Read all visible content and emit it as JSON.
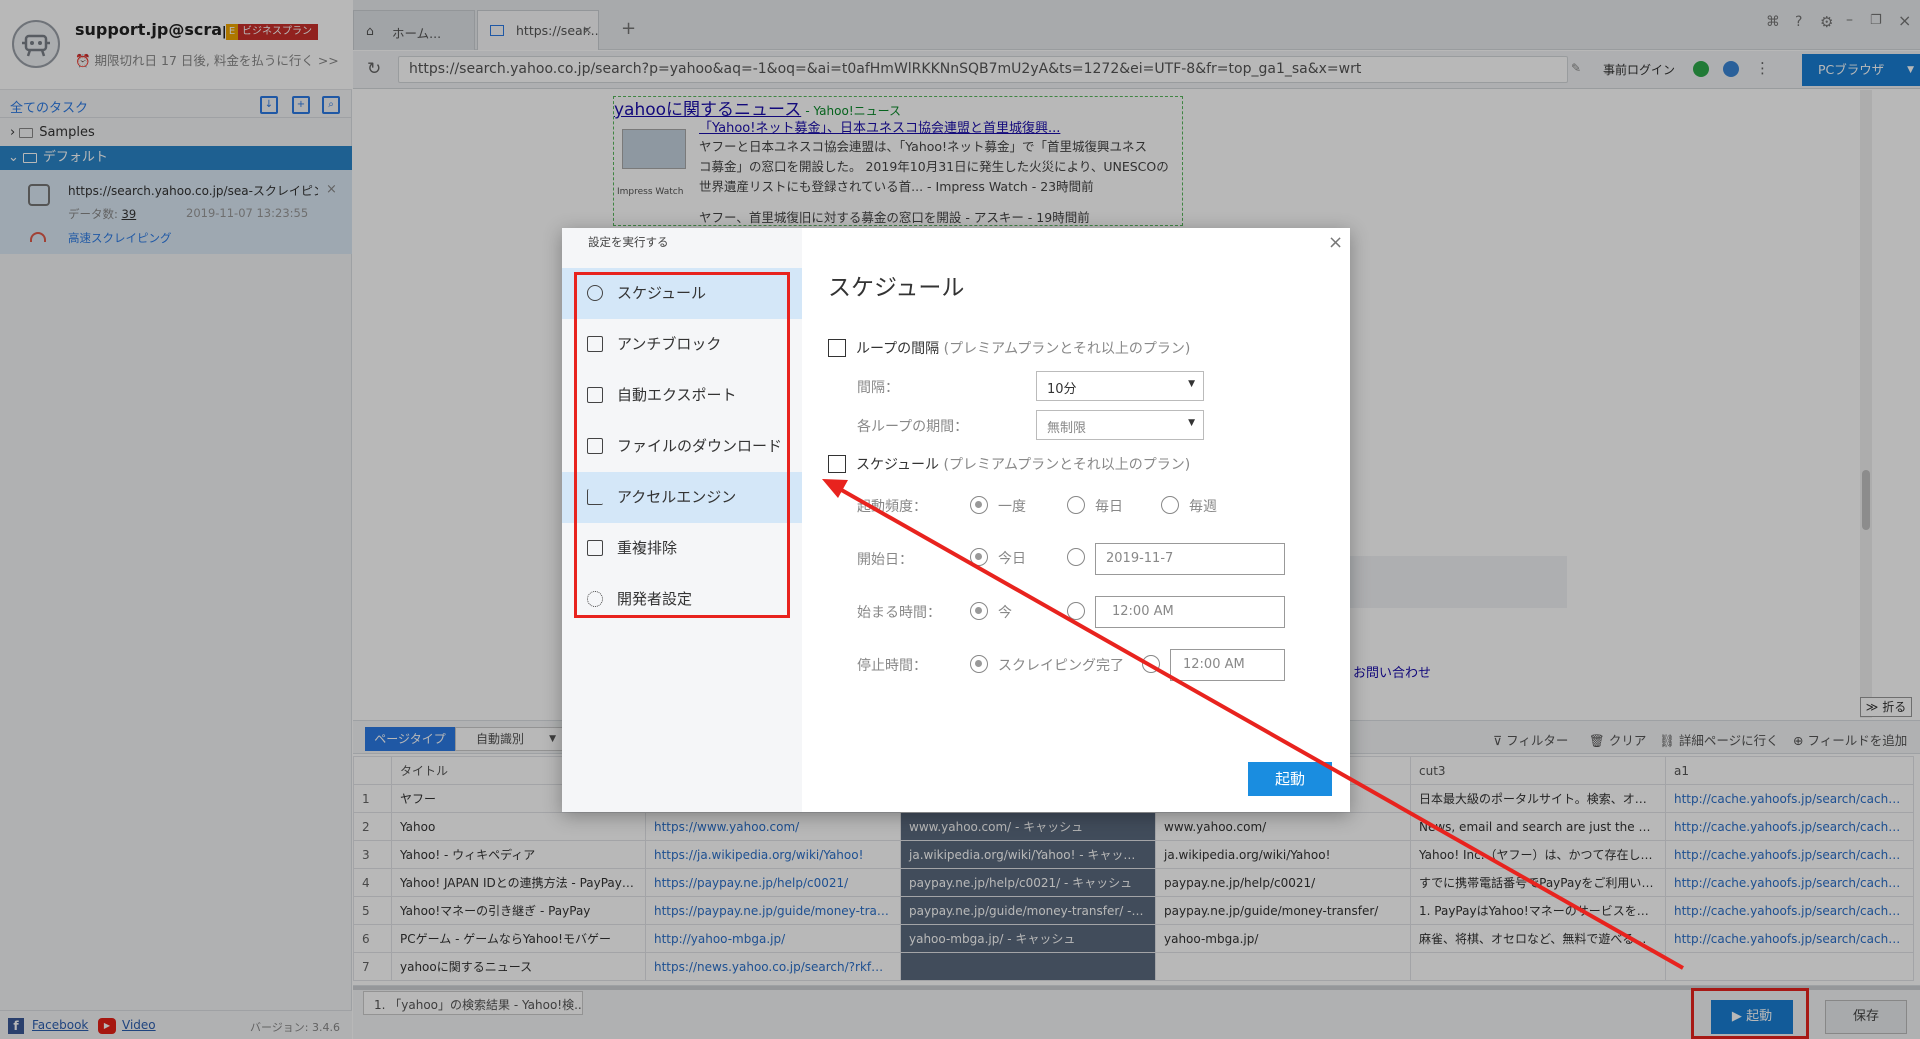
{
  "account": {
    "name": "support.jp@scrap...",
    "plan": "ビジネスプラン",
    "expire_text": "期限切れ日 17 日後, 料金を払うに行く >>"
  },
  "sidebar": {
    "all_tasks": "全てのタスク",
    "folders": [
      {
        "label": "Samples"
      },
      {
        "label": "デフォルト"
      }
    ],
    "task": {
      "url": "https://search.yahoo.co.jp/sea-スクレイピン...",
      "count_label": "データ数:",
      "count": "39",
      "date": "2019-11-07 13:23:55",
      "mode": "高速スクレイピング"
    },
    "footer": {
      "facebook": "Facebook",
      "video": "Video",
      "version": "バージョン: 3.4.6"
    }
  },
  "browser": {
    "tabs": [
      {
        "label": "ホーム..."
      },
      {
        "label": "https://sear..."
      }
    ],
    "url": "https://search.yahoo.co.jp/search?p=yahoo&aq=-1&oq=&ai=t0afHmWlRKKNnSQB7mU2yA&ts=1272&ei=UTF-8&fr=top_ga1_sa&x=wrt",
    "pre_login": "事前ログイン",
    "pc_browser": "PCブラウザ"
  },
  "webpage": {
    "news_title": "yahooに関するニュース",
    "news_source": "- Yahoo!ニュース",
    "article_title": "「Yahoo!ネット募金」、日本ユネスコ協会連盟と首里城復興...",
    "article_lines": [
      "ヤフーと日本ユネスコ協会連盟は、「Yahoo!ネット募金」で「首里城復興ユネス",
      "コ募金」の窓口を開設した。 2019年10月31日に発生した火災により、UNESCOの",
      "世界遺産リストにも登録されている首... - Impress Watch - 23時間前"
    ],
    "thumb_caption": "Impress Watch",
    "article2": "ヤフー、首里城復旧に対する募金の窓口を開設 - アスキー - 19時間前",
    "contact": "お問い合わせ",
    "fold": "折る"
  },
  "panel": {
    "page_type": "ページタイプ",
    "auto_detect": "自動識別",
    "tools": [
      "フィルター",
      "クリア",
      "詳細ページに行く",
      "フィールドを追加"
    ],
    "columns": [
      "タイトル",
      "",
      "",
      "",
      "cut3",
      "a1"
    ],
    "rows": [
      {
        "n": "1",
        "c": [
          "ヤフー",
          "",
          "",
          "",
          "日本最大級のポータルサイト。検索、オー...",
          "http://cache.yahoofs.jp/search/cache?c=Ul..."
        ]
      },
      {
        "n": "2",
        "c": [
          "Yahoo",
          "https://www.yahoo.com/",
          "www.yahoo.com/ - キャッシュ",
          "www.yahoo.com/",
          "News, email and search are just the beginn...",
          "http://cache.yahoofs.jp/search/cache?c=J2..."
        ]
      },
      {
        "n": "3",
        "c": [
          "Yahoo! - ウィキペディア",
          "https://ja.wikipedia.org/wiki/Yahoo!",
          "ja.wikipedia.org/wiki/Yahoo! - キャッシュ",
          "ja.wikipedia.org/wiki/Yahoo!",
          "Yahoo! Inc.（ヤフー）は、かつて存在した...",
          "http://cache.yahoofs.jp/search/cache?c=Lg..."
        ]
      },
      {
        "n": "4",
        "c": [
          "Yahoo! JAPAN IDとの連携方法 - PayPay よ...",
          "https://paypay.ne.jp/help/c0021/",
          "paypay.ne.jp/help/c0021/ - キャッシュ",
          "paypay.ne.jp/help/c0021/",
          "すでに携帯電話番号でPayPayをご利用いた...",
          "http://cache.yahoofs.jp/search/cache?c=lw..."
        ]
      },
      {
        "n": "5",
        "c": [
          "Yahoo!マネーの引き継ぎ - PayPay",
          "https://paypay.ne.jp/guide/money-transfer/",
          "paypay.ne.jp/guide/money-transfer/ - キャ...",
          "paypay.ne.jp/guide/money-transfer/",
          "1. PayPayはYahoo!マネーのサービスを引...",
          "http://cache.yahoofs.jp/search/cache?c=4A..."
        ]
      },
      {
        "n": "6",
        "c": [
          "PCゲーム - ゲームならYahoo!モバゲー",
          "http://yahoo-mbga.jp/",
          "yahoo-mbga.jp/ - キャッシュ",
          "yahoo-mbga.jp/",
          "麻雀、将棋、オセロなど、無料で遊べる対...",
          "http://cache.yahoofs.jp/search/cache?c=V7..."
        ]
      },
      {
        "n": "7",
        "c": [
          "yahooに関するニュース",
          "https://news.yahoo.co.jp/search/?rkf=2&ei=...",
          "",
          "",
          "",
          ""
        ]
      }
    ],
    "bottom_tab": "1. 「yahoo」の検索結果 - Yahoo!検...",
    "start": "起動",
    "save": "保存"
  },
  "dialog": {
    "header": "設定を実行する",
    "menu": [
      {
        "label": "スケジュール"
      },
      {
        "label": "アンチブロック"
      },
      {
        "label": "自動エクスポート"
      },
      {
        "label": "ファイルのダウンロード"
      },
      {
        "label": "アクセルエンジン"
      },
      {
        "label": "重複排除"
      },
      {
        "label": "開発者設定"
      }
    ],
    "title": "スケジュール",
    "loop_label": "ループの間隔",
    "premium_note": "(プレミアムプランとそれ以上のプラン)",
    "interval_label": "間隔：",
    "interval_value": "10分",
    "period_label": "各ループの期間：",
    "period_value": "無制限",
    "schedule_label": "スケジュール",
    "freq_label": "起動頻度：",
    "freq_options": [
      "一度",
      "毎日",
      "毎週"
    ],
    "start_date_label": "開始日：",
    "today": "今日",
    "start_date_value": "2019-11-7",
    "start_time_label": "始まる時間：",
    "now": "今",
    "start_time_value": "12:00 AM",
    "stop_label": "停止時間：",
    "stop_option": "スクレイピング完了",
    "stop_time_value": "12:00 AM",
    "start_button": "起動"
  },
  "colors": {
    "accent": "#1a7fd4",
    "highlight": "#e8231e"
  }
}
